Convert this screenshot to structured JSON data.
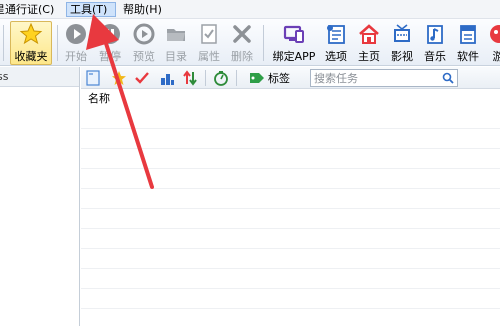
{
  "menu": [
    {
      "label": "星通行证(C)"
    },
    {
      "label": "工具(T)"
    },
    {
      "label": "帮助(H)"
    }
  ],
  "toolbar": {
    "favorites": "收藏夹",
    "start": "开始",
    "pause": "暂停",
    "preview": "预览",
    "folder": "目录",
    "properties": "属性",
    "delete": "删除",
    "bind_app": "绑定APP",
    "options": "选项",
    "home": "主页",
    "video": "影视",
    "music": "音乐",
    "software": "软件",
    "games": "游"
  },
  "left_panel": {
    "header": "ss"
  },
  "subtoolbar": {
    "tag_label": "标签",
    "search_placeholder": "搜索任务"
  },
  "task_list": {
    "column_name": "名称",
    "rows": [
      "",
      "",
      "",
      "",
      "",
      "",
      "",
      "",
      "",
      "",
      ""
    ]
  },
  "colors": {
    "accent_red": "#e8393f",
    "selection": "#cfe3fb"
  }
}
